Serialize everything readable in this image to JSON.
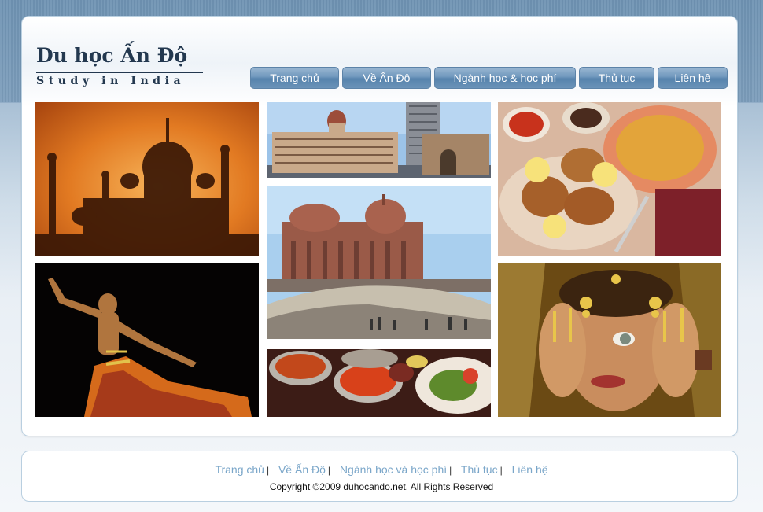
{
  "logo": {
    "title": "Du học Ấn Độ",
    "subtitle": "Study in India"
  },
  "nav": {
    "items": [
      "Trang chủ",
      "Về Ấn Độ",
      "Ngành học & học phí",
      "Thủ tục",
      "Liên hệ"
    ]
  },
  "gallery": {
    "items": [
      "taj-mahal-sunset",
      "taj-mahal-palace-hotel-mumbai",
      "indian-food-plate",
      "indian-dancer",
      "vivekananda-rock-memorial",
      "indian-curry-bowls",
      "indian-bride-portrait"
    ]
  },
  "footer": {
    "links": [
      "Trang chủ",
      "Về Ấn Độ",
      "Ngành học và học phí",
      "Thủ tục",
      "Liên hệ"
    ],
    "separator": "|",
    "copyright": "Copyright ©2009 duhocando.net. All Rights Reserved"
  },
  "colors": {
    "header_blue": "#6f93b3",
    "nav_button": "#6f97bd",
    "logo_text": "#23384f",
    "footer_link": "#7aa6c9"
  }
}
